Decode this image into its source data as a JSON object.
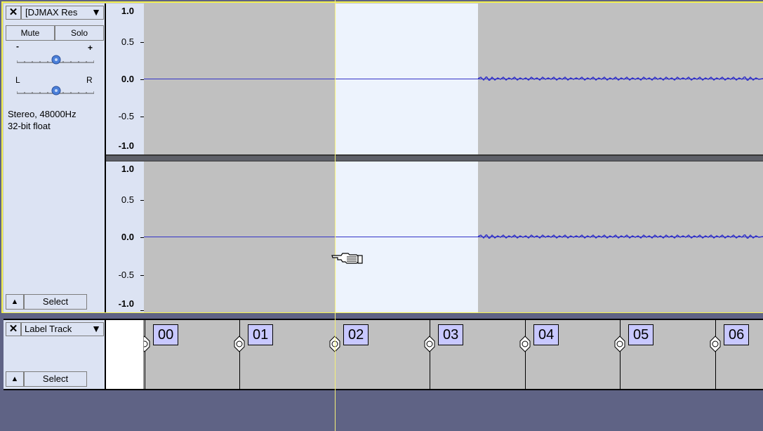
{
  "audio_track": {
    "name": "[DJMAX Res",
    "mute_label": "Mute",
    "solo_label": "Solo",
    "gain_minus": "-",
    "gain_plus": "+",
    "pan_left": "L",
    "pan_right": "R",
    "format_line1": "Stereo, 48000Hz",
    "format_line2": "32-bit float",
    "select_label": "Select",
    "gain_value": 0.5,
    "pan_value": 0.5
  },
  "vertical_ruler": {
    "ticks": [
      "1.0",
      "0.5",
      "0.0",
      "-0.5",
      "-1.0"
    ]
  },
  "label_track": {
    "name": "Label Track",
    "select_label": "Select",
    "labels": [
      "00",
      "01",
      "02",
      "03",
      "04",
      "05",
      "06"
    ]
  },
  "colors": {
    "waveform": "#3232c8",
    "selection": "#edf3fd",
    "track_bg": "#c0c0c0",
    "panel_bg": "#dce3f3",
    "label_box": "#c8c8ff",
    "cursor": "#f5f078",
    "focus_border": "#f2f04e"
  },
  "icons": {
    "close": "close-icon",
    "menu": "dropdown-arrow-icon",
    "collapse": "collapse-arrow-icon",
    "pointer": "pointing-hand-cursor-icon"
  }
}
